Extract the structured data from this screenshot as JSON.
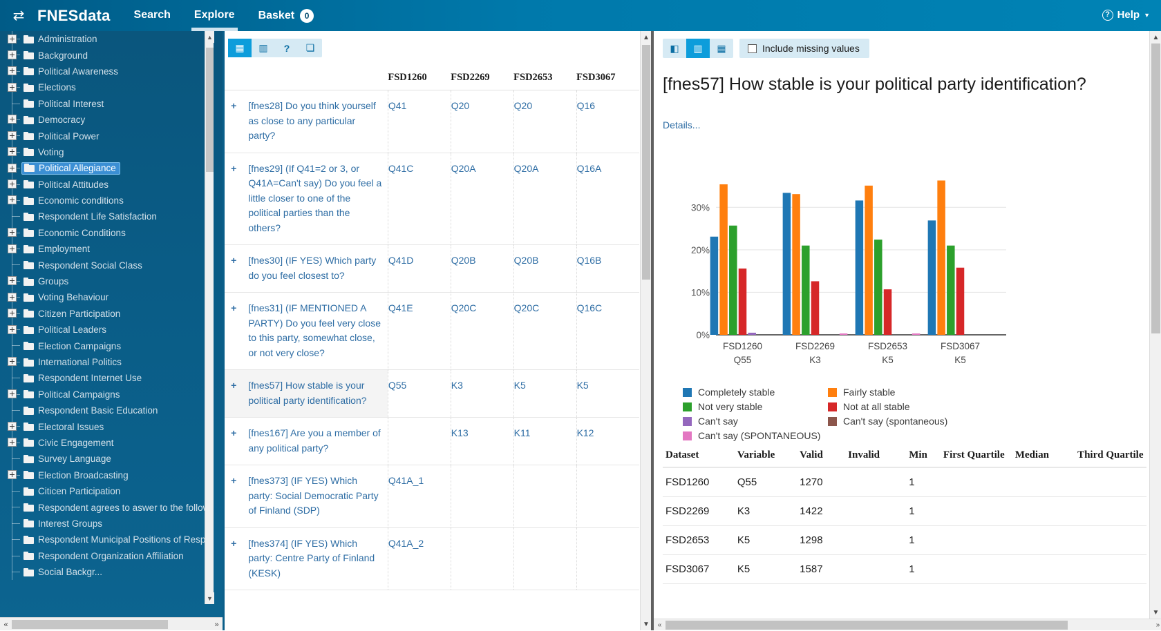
{
  "topnav": {
    "swap_icon": "swap-icon",
    "brand": "FNESdata",
    "links": [
      {
        "label": "Search",
        "active": false
      },
      {
        "label": "Explore",
        "active": true
      }
    ],
    "basket_label": "Basket",
    "basket_count": "0",
    "help_label": "Help"
  },
  "tree": {
    "items": [
      {
        "label": "Administration",
        "expandable": true,
        "selected": false
      },
      {
        "label": "Background",
        "expandable": true,
        "selected": false
      },
      {
        "label": "Political Awareness",
        "expandable": true,
        "selected": false
      },
      {
        "label": "Elections",
        "expandable": true,
        "selected": false
      },
      {
        "label": "Political Interest",
        "expandable": false,
        "selected": false
      },
      {
        "label": "Democracy",
        "expandable": true,
        "selected": false
      },
      {
        "label": "Political Power",
        "expandable": true,
        "selected": false
      },
      {
        "label": "Voting",
        "expandable": true,
        "selected": false
      },
      {
        "label": "Political Allegiance",
        "expandable": true,
        "selected": true
      },
      {
        "label": "Political Attitudes",
        "expandable": true,
        "selected": false
      },
      {
        "label": "Economic conditions",
        "expandable": true,
        "selected": false
      },
      {
        "label": "Respondent Life Satisfaction",
        "expandable": false,
        "selected": false
      },
      {
        "label": "Economic Conditions",
        "expandable": true,
        "selected": false
      },
      {
        "label": "Employment",
        "expandable": true,
        "selected": false
      },
      {
        "label": "Respondent Social Class",
        "expandable": false,
        "selected": false
      },
      {
        "label": "Groups",
        "expandable": true,
        "selected": false
      },
      {
        "label": "Voting Behaviour",
        "expandable": true,
        "selected": false
      },
      {
        "label": "Citizen Participation",
        "expandable": true,
        "selected": false
      },
      {
        "label": "Political Leaders",
        "expandable": true,
        "selected": false
      },
      {
        "label": "Election Campaigns",
        "expandable": false,
        "selected": false
      },
      {
        "label": "International Politics",
        "expandable": true,
        "selected": false
      },
      {
        "label": "Respondent Internet Use",
        "expandable": false,
        "selected": false
      },
      {
        "label": "Political Campaigns",
        "expandable": true,
        "selected": false
      },
      {
        "label": "Respondent Basic Education",
        "expandable": false,
        "selected": false
      },
      {
        "label": "Electoral Issues",
        "expandable": true,
        "selected": false
      },
      {
        "label": "Civic Engagement",
        "expandable": true,
        "selected": false
      },
      {
        "label": "Survey Language",
        "expandable": false,
        "selected": false
      },
      {
        "label": "Election Broadcasting",
        "expandable": true,
        "selected": false
      },
      {
        "label": "Citicen Participation",
        "expandable": false,
        "selected": false
      },
      {
        "label": "Respondent agrees to aswer to the follow up questions",
        "expandable": false,
        "selected": false
      },
      {
        "label": "Interest Groups",
        "expandable": false,
        "selected": false
      },
      {
        "label": "Respondent Municipal Positions of Responsibility",
        "expandable": false,
        "selected": false
      },
      {
        "label": "Respondent Organization Affiliation",
        "expandable": false,
        "selected": false
      },
      {
        "label": "Social Backgr...",
        "expandable": false,
        "selected": false
      }
    ]
  },
  "mid_toolbar": {
    "buttons": [
      {
        "icon": "table-grid-icon",
        "name": "view-table-button",
        "active": true
      },
      {
        "icon": "bar-chart-icon",
        "name": "view-chart-button",
        "active": false
      },
      {
        "icon": "question-mark-icon",
        "name": "help-button",
        "active": false
      },
      {
        "icon": "book-icon",
        "name": "codebook-button",
        "active": false
      }
    ]
  },
  "question_table": {
    "columns": [
      "",
      "",
      "FSD1260",
      "FSD2269",
      "FSD2653",
      "FSD3067"
    ],
    "rows": [
      {
        "expand": "+",
        "question": "[fnes28] Do you think yourself as close to any particular party?",
        "codes": [
          "Q41",
          "Q20",
          "Q20",
          "Q16"
        ],
        "selected": false
      },
      {
        "expand": "+",
        "question": "[fnes29] (If Q41=2 or 3, or Q41A=Can't say) Do you feel a little closer to one of the political parties than the others?",
        "codes": [
          "Q41C",
          "Q20A",
          "Q20A",
          "Q16A"
        ],
        "selected": false
      },
      {
        "expand": "+",
        "question": "[fnes30] (IF YES) Which party do you feel closest to?",
        "codes": [
          "Q41D",
          "Q20B",
          "Q20B",
          "Q16B"
        ],
        "selected": false
      },
      {
        "expand": "+",
        "question": "[fnes31] (IF MENTIONED A PARTY) Do you feel very close to this party, somewhat close, or not very close?",
        "codes": [
          "Q41E",
          "Q20C",
          "Q20C",
          "Q16C"
        ],
        "selected": false
      },
      {
        "expand": "+",
        "question": "[fnes57] How stable is your political party identification?",
        "codes": [
          "Q55",
          "K3",
          "K5",
          "K5"
        ],
        "selected": true
      },
      {
        "expand": "+",
        "question": "[fnes167] Are you a member of any political party?",
        "codes": [
          "",
          "K13",
          "K11",
          "K12"
        ],
        "selected": false
      },
      {
        "expand": "+",
        "question": "[fnes373] (IF YES) Which party: Social Democratic Party of Finland (SDP)",
        "codes": [
          "Q41A_1",
          "",
          "",
          ""
        ],
        "selected": false
      },
      {
        "expand": "+",
        "question": "[fnes374] (IF YES) Which party: Centre Party of Finland (KESK)",
        "codes": [
          "Q41A_2",
          "",
          "",
          ""
        ],
        "selected": false
      }
    ]
  },
  "right_toolbar": {
    "buttons": [
      {
        "icon": "collapse-panel-icon",
        "name": "collapse-panel-button",
        "active": false
      },
      {
        "icon": "bar-chart-icon",
        "name": "view-chart-button",
        "active": true
      },
      {
        "icon": "table-grid-icon",
        "name": "view-table-button",
        "active": false
      }
    ],
    "missing_values_label": "Include missing values",
    "missing_values_checked": false
  },
  "detail": {
    "title": "[fnes57] How stable is your political party identification?",
    "details_link": "Details..."
  },
  "chart_data": {
    "type": "bar",
    "title": "",
    "xlabel": "",
    "ylabel": "",
    "ylim": [
      0,
      38
    ],
    "yticks": [
      0,
      10,
      20,
      30
    ],
    "ytick_labels": [
      "0%",
      "10%",
      "20%",
      "30%"
    ],
    "grid": true,
    "legend_position": "bottom",
    "categories": [
      "FSD1260",
      "FSD2269",
      "FSD2653",
      "FSD3067"
    ],
    "category_sublabels": [
      "Q55",
      "K3",
      "K5",
      "K5"
    ],
    "series": [
      {
        "name": "Completely stable",
        "color": "#1f77b4",
        "values": [
          23.1,
          33.4,
          31.6,
          26.9
        ]
      },
      {
        "name": "Fairly stable",
        "color": "#ff7f0e",
        "values": [
          35.4,
          33.1,
          35.1,
          36.3
        ]
      },
      {
        "name": "Not very stable",
        "color": "#2ca02c",
        "values": [
          25.7,
          21.0,
          22.4,
          21.0
        ]
      },
      {
        "name": "Not at all stable",
        "color": "#d62728",
        "values": [
          15.6,
          12.6,
          10.7,
          15.8
        ]
      },
      {
        "name": "Can't say",
        "color": "#9467bd",
        "values": [
          0.5,
          0.0,
          0.0,
          0.0
        ]
      },
      {
        "name": "Can't say (spontaneous)",
        "color": "#8c564b",
        "values": [
          0.0,
          0.0,
          0.0,
          0.0
        ]
      },
      {
        "name": "Can't say (SPONTANEOUS)",
        "color": "#e377c2",
        "values": [
          0.0,
          0.15,
          0.25,
          0.0
        ]
      }
    ]
  },
  "stats_table": {
    "columns": [
      "Dataset",
      "Variable",
      "Valid",
      "Invalid",
      "Min",
      "First Quartile",
      "Median",
      "Third Quartile"
    ],
    "rows": [
      {
        "dataset": "FSD1260",
        "variable": "Q55",
        "valid": "1270",
        "invalid": "",
        "min": "1",
        "q1": "",
        "median": "",
        "q3": ""
      },
      {
        "dataset": "FSD2269",
        "variable": "K3",
        "valid": "1422",
        "invalid": "",
        "min": "1",
        "q1": "",
        "median": "",
        "q3": ""
      },
      {
        "dataset": "FSD2653",
        "variable": "K5",
        "valid": "1298",
        "invalid": "",
        "min": "1",
        "q1": "",
        "median": "",
        "q3": ""
      },
      {
        "dataset": "FSD3067",
        "variable": "K5",
        "valid": "1587",
        "invalid": "",
        "min": "1",
        "q1": "",
        "median": "",
        "q3": ""
      }
    ]
  }
}
